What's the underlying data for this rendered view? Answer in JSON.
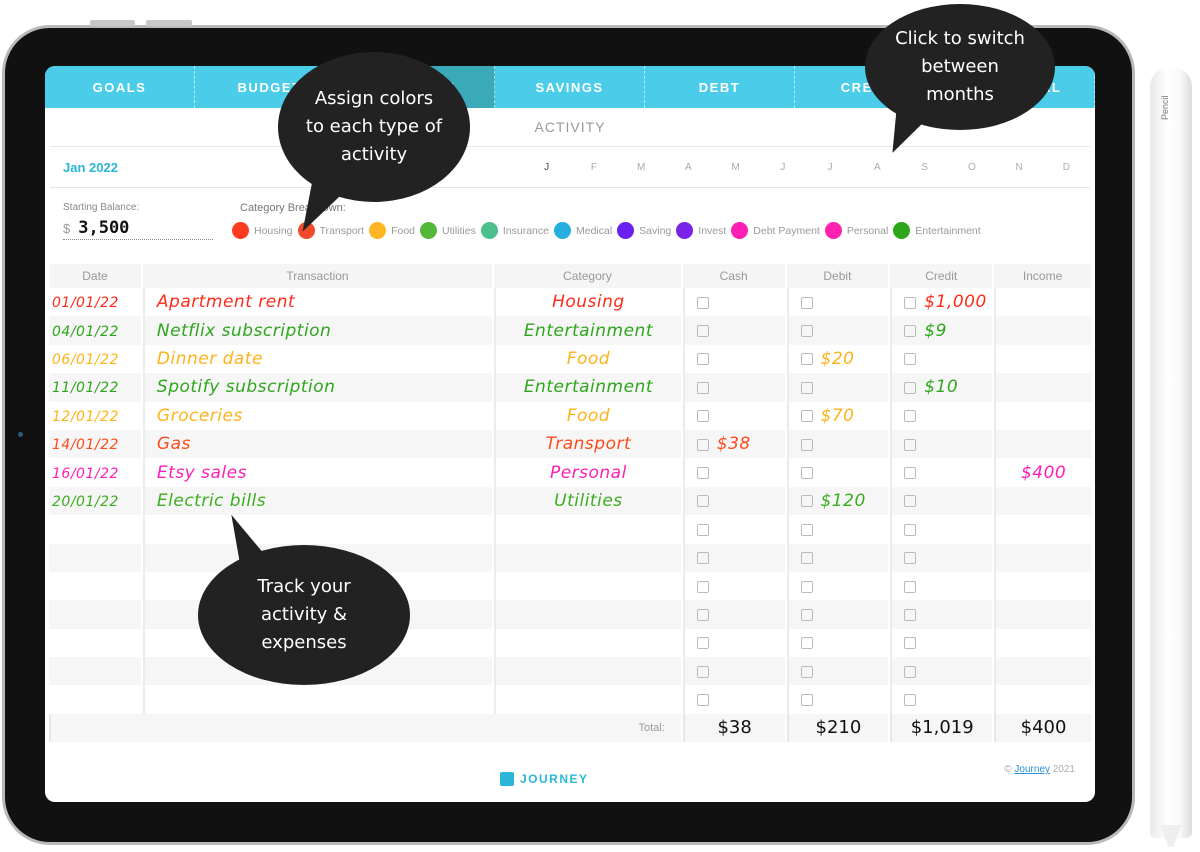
{
  "tabs": [
    {
      "label": "GOALS",
      "active": false
    },
    {
      "label": "BUDGET",
      "active": false
    },
    {
      "label": "ACTIVITY",
      "active": true
    },
    {
      "label": "SAVINGS",
      "active": false
    },
    {
      "label": "DEBT",
      "active": false
    },
    {
      "label": "CREDIT",
      "active": false
    },
    {
      "label": "FINANCIAL",
      "active": false
    }
  ],
  "section_title": "ACTIVITY",
  "current_month": "Jan 2022",
  "months": [
    "J",
    "F",
    "M",
    "A",
    "M",
    "J",
    "J",
    "A",
    "S",
    "O",
    "N",
    "D"
  ],
  "starting_balance": {
    "label": "Starting Balance:",
    "currency": "$",
    "value": "3,500"
  },
  "category_breakdown": {
    "label": "Category Breakdown:",
    "items": [
      {
        "name": "Housing",
        "color": "#ff3b1f"
      },
      {
        "name": "Transport",
        "color": "#f04a2a"
      },
      {
        "name": "Food",
        "color": "#ffb624"
      },
      {
        "name": "Utilities",
        "color": "#53b83a"
      },
      {
        "name": "Insurance",
        "color": "#4cc08c"
      },
      {
        "name": "Medical",
        "color": "#27aee0"
      },
      {
        "name": "Saving",
        "color": "#6a20ee"
      },
      {
        "name": "Invest",
        "color": "#7a22e8"
      },
      {
        "name": "Debt Payment",
        "color": "#ff1eb4"
      },
      {
        "name": "Personal",
        "color": "#ff22b0"
      },
      {
        "name": "Entertainment",
        "color": "#2ea61c"
      }
    ]
  },
  "table": {
    "headers": [
      "Date",
      "Transaction",
      "Category",
      "Cash",
      "Debit",
      "Credit",
      "Income"
    ],
    "rows": [
      {
        "date": "01/01/22",
        "transaction": "Apartment rent",
        "category": "Housing",
        "cash": "",
        "debit": "",
        "credit": "$1,000",
        "income": "",
        "color": "#ff2a1a"
      },
      {
        "date": "04/01/22",
        "transaction": "Netflix subscription",
        "category": "Entertainment",
        "cash": "",
        "debit": "",
        "credit": "$9",
        "income": "",
        "color": "#2ea61c"
      },
      {
        "date": "06/01/22",
        "transaction": "Dinner date",
        "category": "Food",
        "cash": "",
        "debit": "$20",
        "credit": "",
        "income": "",
        "color": "#ffb21a"
      },
      {
        "date": "11/01/22",
        "transaction": "Spotify subscription",
        "category": "Entertainment",
        "cash": "",
        "debit": "",
        "credit": "$10",
        "income": "",
        "color": "#2ea61c"
      },
      {
        "date": "12/01/22",
        "transaction": "Groceries",
        "category": "Food",
        "cash": "",
        "debit": "$70",
        "credit": "",
        "income": "",
        "color": "#ffb21a"
      },
      {
        "date": "14/01/22",
        "transaction": "Gas",
        "category": "Transport",
        "cash": "$38",
        "debit": "",
        "credit": "",
        "income": "",
        "color": "#ff4a1a"
      },
      {
        "date": "16/01/22",
        "transaction": "Etsy sales",
        "category": "Personal",
        "cash": "",
        "debit": "",
        "credit": "",
        "income": "$400",
        "color": "#ff1eb4"
      },
      {
        "date": "20/01/22",
        "transaction": "Electric bills",
        "category": "Utilities",
        "cash": "",
        "debit": "$120",
        "credit": "",
        "income": "",
        "color": "#3aae1f"
      },
      {
        "date": "",
        "transaction": "",
        "category": "",
        "cash": "",
        "debit": "",
        "credit": "",
        "income": "",
        "color": "#000"
      },
      {
        "date": "",
        "transaction": "",
        "category": "",
        "cash": "",
        "debit": "",
        "credit": "",
        "income": "",
        "color": "#000"
      },
      {
        "date": "",
        "transaction": "",
        "category": "",
        "cash": "",
        "debit": "",
        "credit": "",
        "income": "",
        "color": "#000"
      },
      {
        "date": "",
        "transaction": "",
        "category": "",
        "cash": "",
        "debit": "",
        "credit": "",
        "income": "",
        "color": "#000"
      },
      {
        "date": "",
        "transaction": "",
        "category": "",
        "cash": "",
        "debit": "",
        "credit": "",
        "income": "",
        "color": "#000"
      },
      {
        "date": "",
        "transaction": "",
        "category": "",
        "cash": "",
        "debit": "",
        "credit": "",
        "income": "",
        "color": "#000"
      },
      {
        "date": "",
        "transaction": "",
        "category": "",
        "cash": "",
        "debit": "",
        "credit": "",
        "income": "",
        "color": "#000"
      }
    ],
    "total_label": "Total:",
    "totals": {
      "cash": "$38",
      "debit": "$210",
      "credit": "$1,019",
      "income": "$400"
    }
  },
  "footer": {
    "brand": "JOURNEY",
    "copyright_prefix": "©",
    "copyright_link": "Journey",
    "copyright_year": "2021"
  },
  "callouts": {
    "colors": "Assign colors to each type of activity",
    "months": "Click to switch between months",
    "track": "Track your activity & expenses"
  },
  "pencil_label": "Pencil"
}
